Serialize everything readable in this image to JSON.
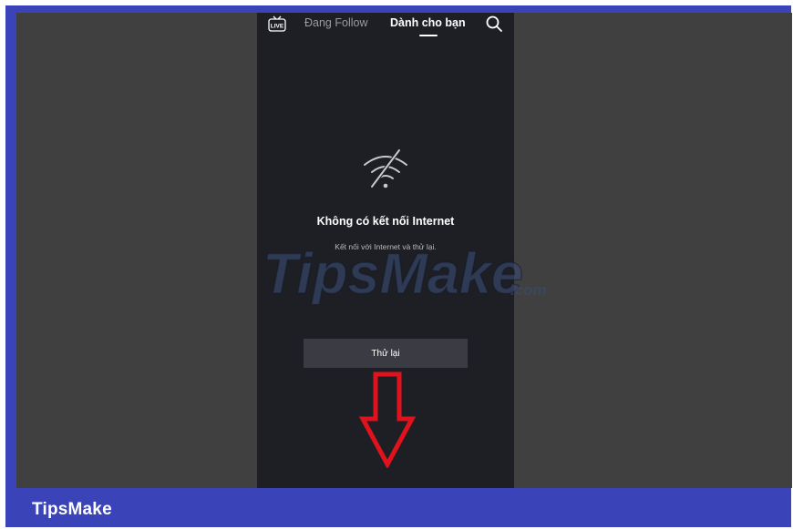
{
  "tabs": {
    "live": "LIVE",
    "following": "Đang Follow",
    "for_you": "Dành cho bạn"
  },
  "error": {
    "title": "Không có kết nối Internet",
    "subtitle": "Kết nối với Internet và thử lại.",
    "retry_label": "Thử lại"
  },
  "watermark": {
    "brand": "TipsMake",
    "suffix": ".com"
  },
  "footer": {
    "label": "TipsMake"
  },
  "colors": {
    "frame": "#3a44b8",
    "backdrop": "#404040",
    "phone_bg": "#1e1f25",
    "retry_bg": "#3b3c43",
    "arrow": "#e0121c"
  },
  "icons": [
    "live-tv-icon",
    "search-icon",
    "wifi-off-icon",
    "down-arrow-annotation"
  ]
}
